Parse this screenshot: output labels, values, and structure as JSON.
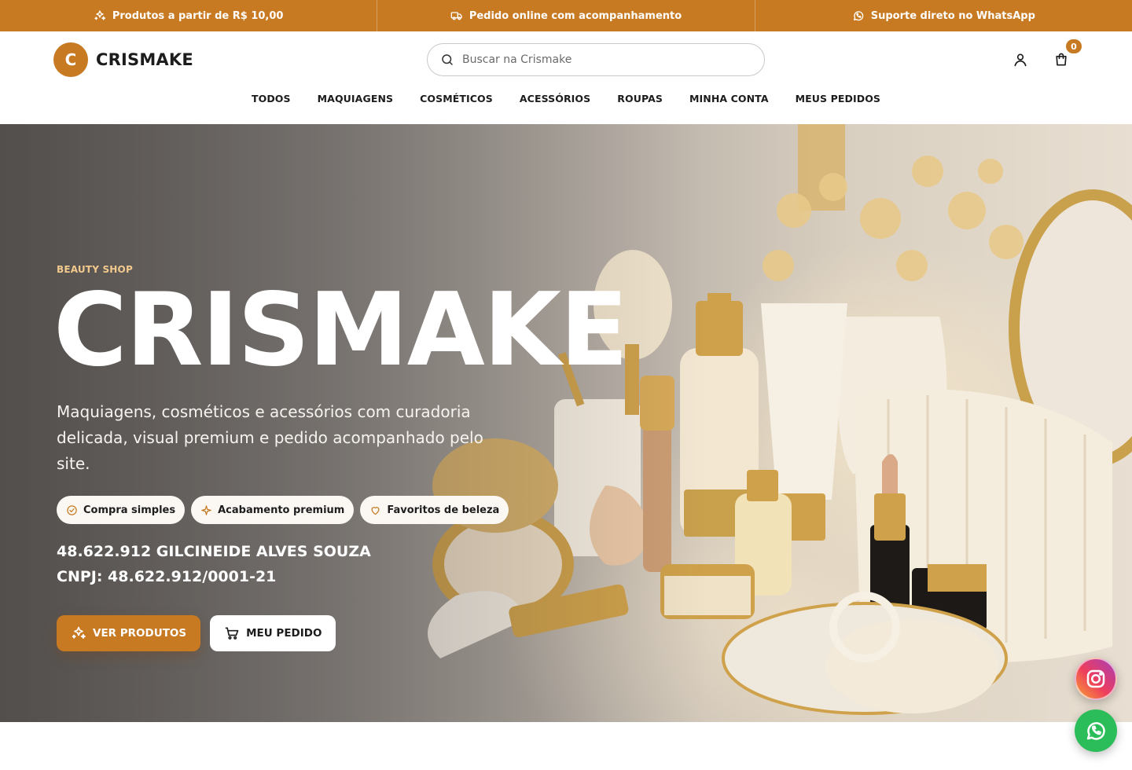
{
  "topbar": {
    "items": [
      {
        "label": "Produtos a partir de R$ 10,00",
        "icon": "sparkles-icon"
      },
      {
        "label": "Pedido online com acompanhamento",
        "icon": "truck-icon"
      },
      {
        "label": "Suporte direto no WhatsApp",
        "icon": "whatsapp-icon"
      }
    ]
  },
  "header": {
    "logo_letter": "C",
    "logo_text": "CRISMAKE",
    "search_placeholder": "Buscar na Crismake",
    "cart_count": "0"
  },
  "nav": {
    "items": [
      "TODOS",
      "MAQUIAGENS",
      "COSMÉTICOS",
      "ACESSÓRIOS",
      "ROUPAS",
      "MINHA CONTA",
      "MEUS PEDIDOS"
    ]
  },
  "hero": {
    "eyebrow": "BEAUTY SHOP",
    "title": "CRISMAKE",
    "subtitle": "Maquiagens, cosméticos e acessórios com curadoria delicada, visual premium e pedido acompanhado pelo site.",
    "chips": [
      {
        "label": "Compra simples",
        "icon": "check-circle-icon"
      },
      {
        "label": "Acabamento premium",
        "icon": "sparkle-icon"
      },
      {
        "label": "Favoritos de beleza",
        "icon": "heart-icon"
      }
    ],
    "company_name": "48.622.912 GILCINEIDE ALVES SOUZA",
    "cnpj": "CNPJ: 48.622.912/0001-21",
    "primary_button": "VER PRODUTOS",
    "secondary_button": "MEU PEDIDO"
  },
  "colors": {
    "accent": "#c77a22",
    "whatsapp": "#2bbd5a"
  }
}
